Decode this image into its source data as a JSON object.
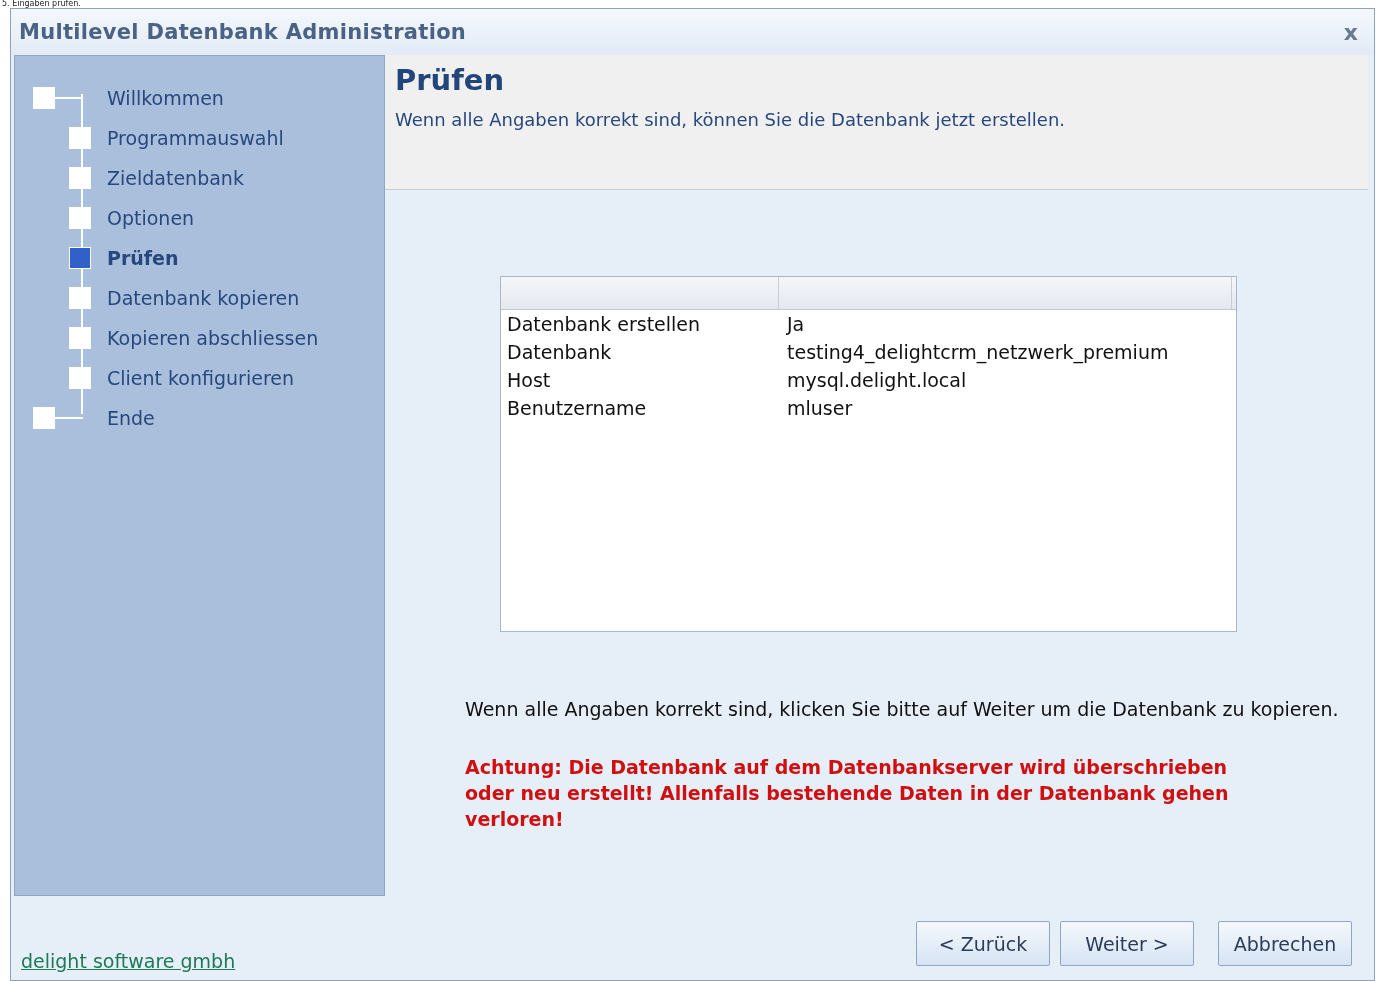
{
  "caption": "5. Eingaben prüfen.",
  "window": {
    "title": "Multilevel Datenbank Administration",
    "close": "x"
  },
  "steps": [
    {
      "label": "Willkommen",
      "kind": "start",
      "selected": false
    },
    {
      "label": "Programmauswahl",
      "kind": "step",
      "selected": false
    },
    {
      "label": "Zieldatenbank",
      "kind": "step",
      "selected": false
    },
    {
      "label": "Optionen",
      "kind": "step",
      "selected": false
    },
    {
      "label": "Prüfen",
      "kind": "step",
      "selected": true
    },
    {
      "label": "Datenbank kopieren",
      "kind": "step",
      "selected": false
    },
    {
      "label": "Kopieren abschliessen",
      "kind": "step",
      "selected": false
    },
    {
      "label": "Client konfigurieren",
      "kind": "step",
      "selected": false
    },
    {
      "label": "Ende",
      "kind": "end",
      "selected": false
    }
  ],
  "header": {
    "title": "Prüfen",
    "subtitle": "Wenn alle Angaben korrekt sind, können Sie die Datenbank jetzt erstellen."
  },
  "table": {
    "rows": [
      {
        "name": "Datenbank erstellen",
        "value": "Ja"
      },
      {
        "name": "Datenbank",
        "value": "testing4_delightcrm_netzwerk_premium"
      },
      {
        "name": "Host",
        "value": "mysql.delight.local"
      },
      {
        "name": "Benutzername",
        "value": "mluser"
      }
    ]
  },
  "info": "Wenn alle Angaben korrekt sind, klicken Sie bitte auf Weiter um die Datenbank zu kopieren.",
  "warning": "Achtung: Die Datenbank auf dem Datenbankserver wird überschrieben oder neu erstellt! Allenfalls bestehende Daten in der Datenbank gehen verloren!",
  "footer": {
    "link": "delight software gmbh"
  },
  "buttons": [
    "< Zurück",
    "Weiter >",
    "Abbrechen"
  ]
}
